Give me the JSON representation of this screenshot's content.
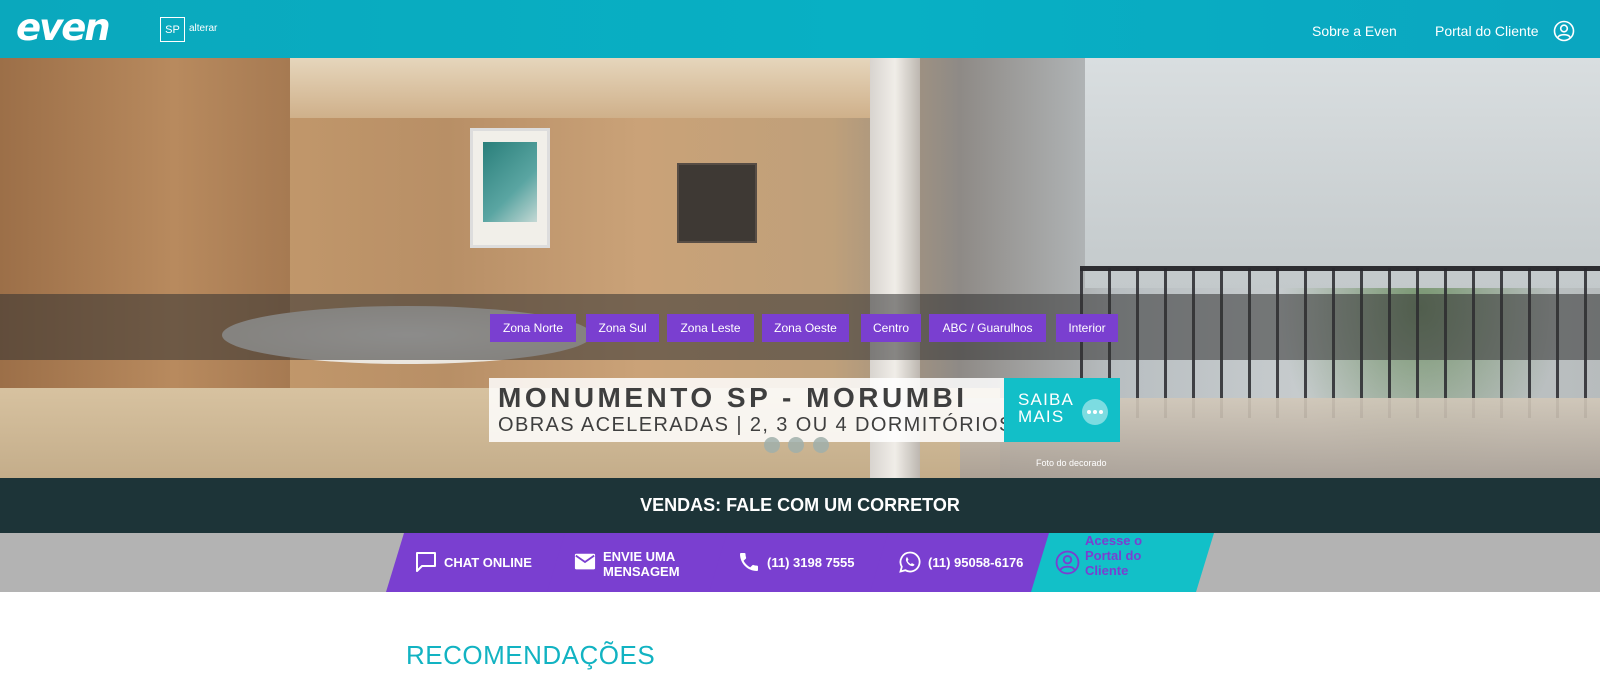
{
  "header": {
    "logo": "even",
    "region_code": "SP",
    "region_change": "alterar",
    "nav": {
      "about": "Sobre a Even",
      "portal": "Portal do Cliente"
    }
  },
  "hero": {
    "filters": [
      "Zona Norte",
      "Zona Sul",
      "Zona Leste",
      "Zona Oeste",
      "Centro",
      "ABC / Guarulhos",
      "Interior"
    ],
    "promo_title": "MONUMENTO SP - MORUMBI",
    "promo_subtitle": "OBRAS ACELERADAS | 2, 3 OU 4 DORMITÓRIOS",
    "more_label": "SAIBA MAIS",
    "carousel_dots": 3,
    "photo_caption": "Foto do decorado"
  },
  "sales": {
    "prefix": "VENDAS:",
    "text": "FALE COM UM CORRETOR"
  },
  "contacts": {
    "chat": "CHAT ONLINE",
    "message": "ENVIE UMA MENSAGEM",
    "phone": "(11) 3198 7555",
    "whatsapp": "(11) 95058-6176",
    "portal": "Acesse o Portal do Cliente"
  },
  "recommendations": {
    "title": "RECOMENDAÇÕES"
  },
  "colors": {
    "header": "#0aa8bd",
    "purple": "#7a3fd0",
    "teal": "#12c0c8",
    "sales_bar": "#1d3438"
  }
}
